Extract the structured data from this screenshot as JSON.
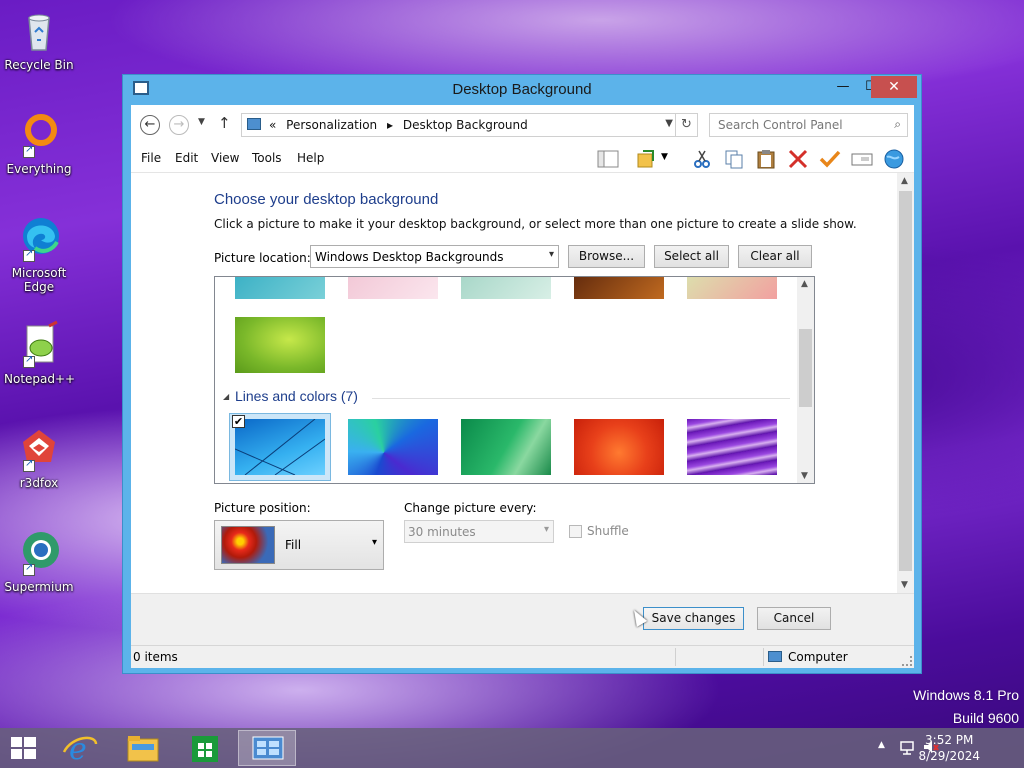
{
  "desktop": {
    "icons": [
      {
        "label": "Recycle Bin",
        "icon": "recycle-bin-icon"
      },
      {
        "label": "Everything",
        "icon": "everything-icon"
      },
      {
        "label": "Microsoft Edge",
        "icon": "edge-icon"
      },
      {
        "label": "Notepad++",
        "icon": "notepadpp-icon"
      },
      {
        "label": "r3dfox",
        "icon": "r3dfox-icon"
      },
      {
        "label": "Supermium",
        "icon": "supermium-icon"
      }
    ],
    "watermark": {
      "line1": "Windows 8.1 Pro",
      "line2": "Build 9600"
    }
  },
  "window": {
    "title": "Desktop Background",
    "controls": {
      "minimize": "—",
      "maximize": "☐",
      "close": "✕"
    },
    "address": {
      "prefix": "«",
      "crumbs": [
        "Personalization",
        "▸",
        "Desktop Background"
      ]
    },
    "search": {
      "placeholder": "Search Control Panel"
    },
    "menu": [
      "File",
      "Edit",
      "View",
      "Tools",
      "Help"
    ],
    "toolbar_icons": [
      "layout-icon",
      "folder-options-icon",
      "cut-icon",
      "copy-icon",
      "paste-icon",
      "delete-icon",
      "properties-icon",
      "rename-icon",
      "globe-icon"
    ]
  },
  "content": {
    "heading": "Choose your desktop background",
    "subtext": "Click a picture to make it your desktop background, or select more than one picture to create a slide show.",
    "picture_location_label": "Picture location:",
    "picture_location_value": "Windows Desktop Backgrounds",
    "browse": "Browse...",
    "select_all": "Select all",
    "clear_all": "Clear all",
    "category": "Lines and colors (7)",
    "picture_position_label": "Picture position:",
    "picture_position_value": "Fill",
    "change_every_label": "Change picture every:",
    "change_every_value": "30 minutes",
    "shuffle": "Shuffle"
  },
  "footer": {
    "save": "Save changes",
    "cancel": "Cancel"
  },
  "statusbar": {
    "items": "0 items",
    "location": "Computer"
  },
  "taskbar": {
    "apps": [
      "internet-explorer-icon",
      "file-explorer-icon",
      "store-icon",
      "control-panel-icon"
    ],
    "time": "3:52 PM",
    "date": "8/29/2024"
  },
  "colors": {
    "accent": "#5cb3ea",
    "heading": "#1e3e8c",
    "close": "#c7504f"
  }
}
